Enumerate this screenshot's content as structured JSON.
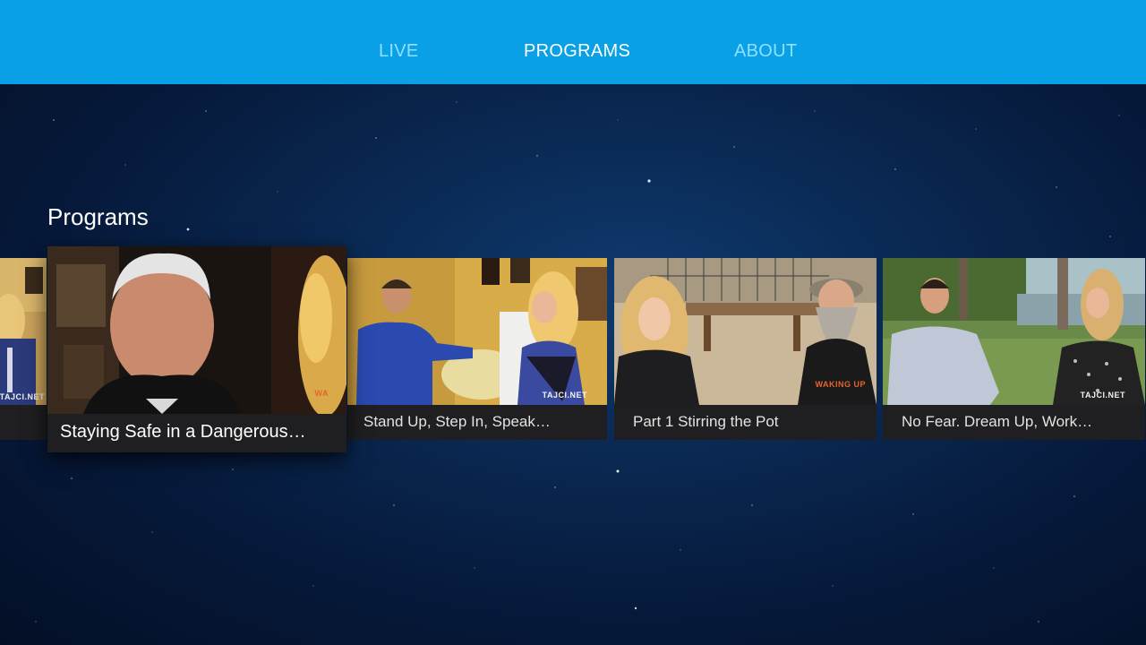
{
  "nav": {
    "items": [
      {
        "label": "LIVE",
        "active": false
      },
      {
        "label": "PROGRAMS",
        "active": true
      },
      {
        "label": "ABOUT",
        "active": false
      }
    ]
  },
  "section": {
    "title": "Programs"
  },
  "programs": [
    {
      "title": "Staying Safe in a Dangerous…",
      "watermark": "WA",
      "focused": true
    },
    {
      "title": "Stand Up, Step In, Speak…",
      "watermark": "TAJCI.NET",
      "focused": false
    },
    {
      "title": "Part 1 Stirring the Pot",
      "watermark": "WAKING UP",
      "focused": false
    },
    {
      "title": "No Fear. Dream Up, Work…",
      "watermark": "TAJCI.NET",
      "focused": false
    }
  ],
  "partial_card_watermark": "TAJCI.NET",
  "colors": {
    "topbar": "#0aa0e6",
    "nav_inactive": "#8fe0ff",
    "nav_active": "#ffffff",
    "caption_bg": "#1f1f21"
  }
}
